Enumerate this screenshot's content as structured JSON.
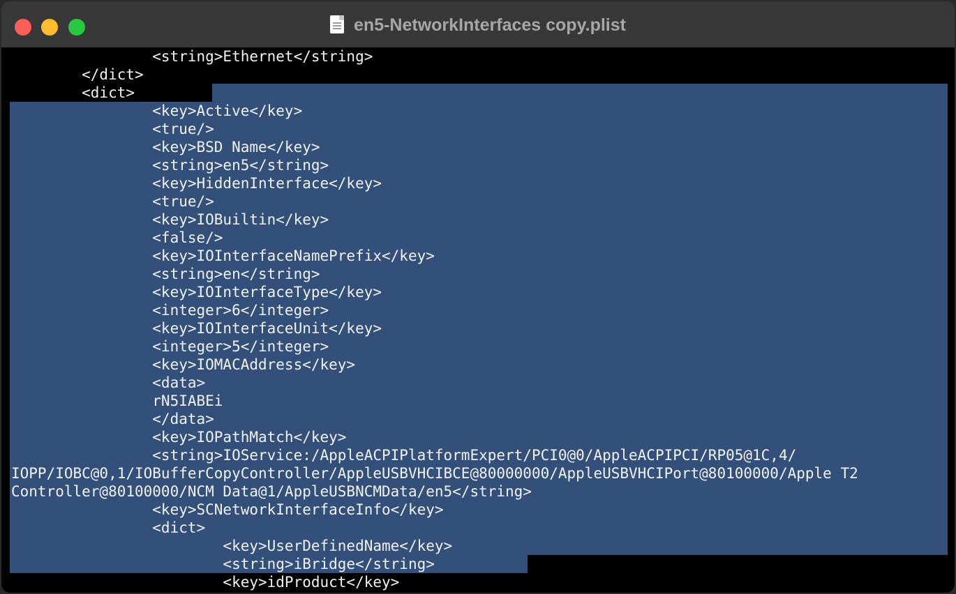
{
  "window": {
    "title": "en5-NetworkInterfaces copy.plist",
    "title_icon": "document-icon",
    "traffic_lights": [
      "close",
      "minimize",
      "maximize"
    ]
  },
  "colors": {
    "selection": "#32507a",
    "text": "#f2f2f2",
    "background": "#000000",
    "titlebar": "#383838"
  },
  "lines": [
    "                <string>Ethernet</string>",
    "        </dict>",
    "        <dict>",
    "                <key>Active</key>",
    "                <true/>",
    "                <key>BSD Name</key>",
    "                <string>en5</string>",
    "                <key>HiddenInterface</key>",
    "                <true/>",
    "                <key>IOBuiltin</key>",
    "                <false/>",
    "                <key>IOInterfaceNamePrefix</key>",
    "                <string>en</string>",
    "                <key>IOInterfaceType</key>",
    "                <integer>6</integer>",
    "                <key>IOInterfaceUnit</key>",
    "                <integer>5</integer>",
    "                <key>IOMACAddress</key>",
    "                <data>",
    "                rN5IABEi",
    "                </data>",
    "                <key>IOPathMatch</key>",
    "                <string>IOService:/AppleACPIPlatformExpert/PCI0@0/AppleACPIPCI/RP05@1C,4/",
    "IOPP/IOBC@0,1/IOBufferCopyController/AppleUSBVHCIBCE@80000000/AppleUSBVHCIPort@80100000/Apple T2",
    "Controller@80100000/NCM Data@1/AppleUSBNCMData/en5</string>",
    "                <key>SCNetworkInterfaceInfo</key>",
    "                <dict>",
    "                        <key>UserDefinedName</key>",
    "                        <string>iBridge</string>",
    "                        <key>idProduct</key>"
  ]
}
